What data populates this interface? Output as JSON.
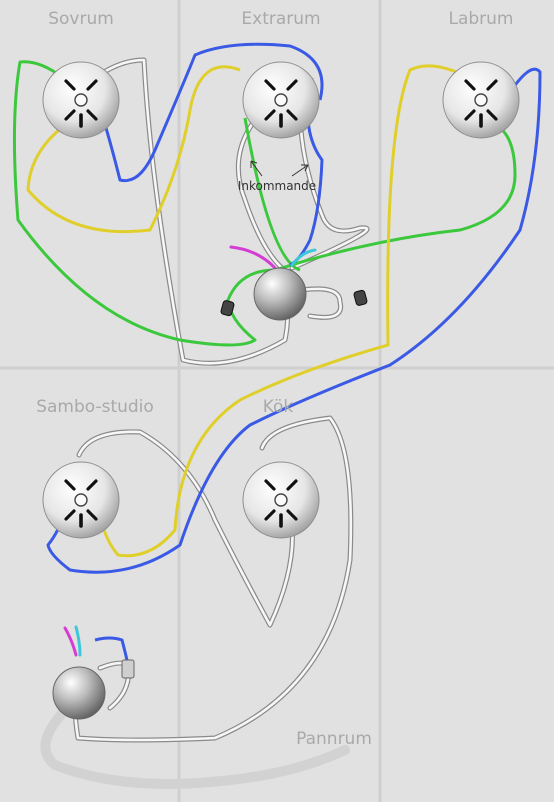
{
  "rooms": {
    "sovrum": "Sovrum",
    "extrarum": "Extrarum",
    "labrum": "Labrum",
    "sambo_studio": "Sambo-studio",
    "kok": "Kök",
    "pannrum": "Pannrum"
  },
  "annotation": "Inkommande",
  "colors": {
    "background": "#e1e1e1",
    "divider": "#cfcfcf",
    "room_label": "#a9a9a9",
    "wire_green": "#3cc83c",
    "wire_yellow": "#e0cf2a",
    "wire_blue": "#3a5ae6",
    "wire_white": "#f7f7f7",
    "wire_outline": "#8a8a8a",
    "wire_magenta": "#d43cd4",
    "wire_cyan": "#3cc8d8"
  },
  "icons": {
    "outlet": "three-prong-outlet-icon",
    "junction": "junction-box-icon",
    "connector": "wire-connector-icon"
  }
}
